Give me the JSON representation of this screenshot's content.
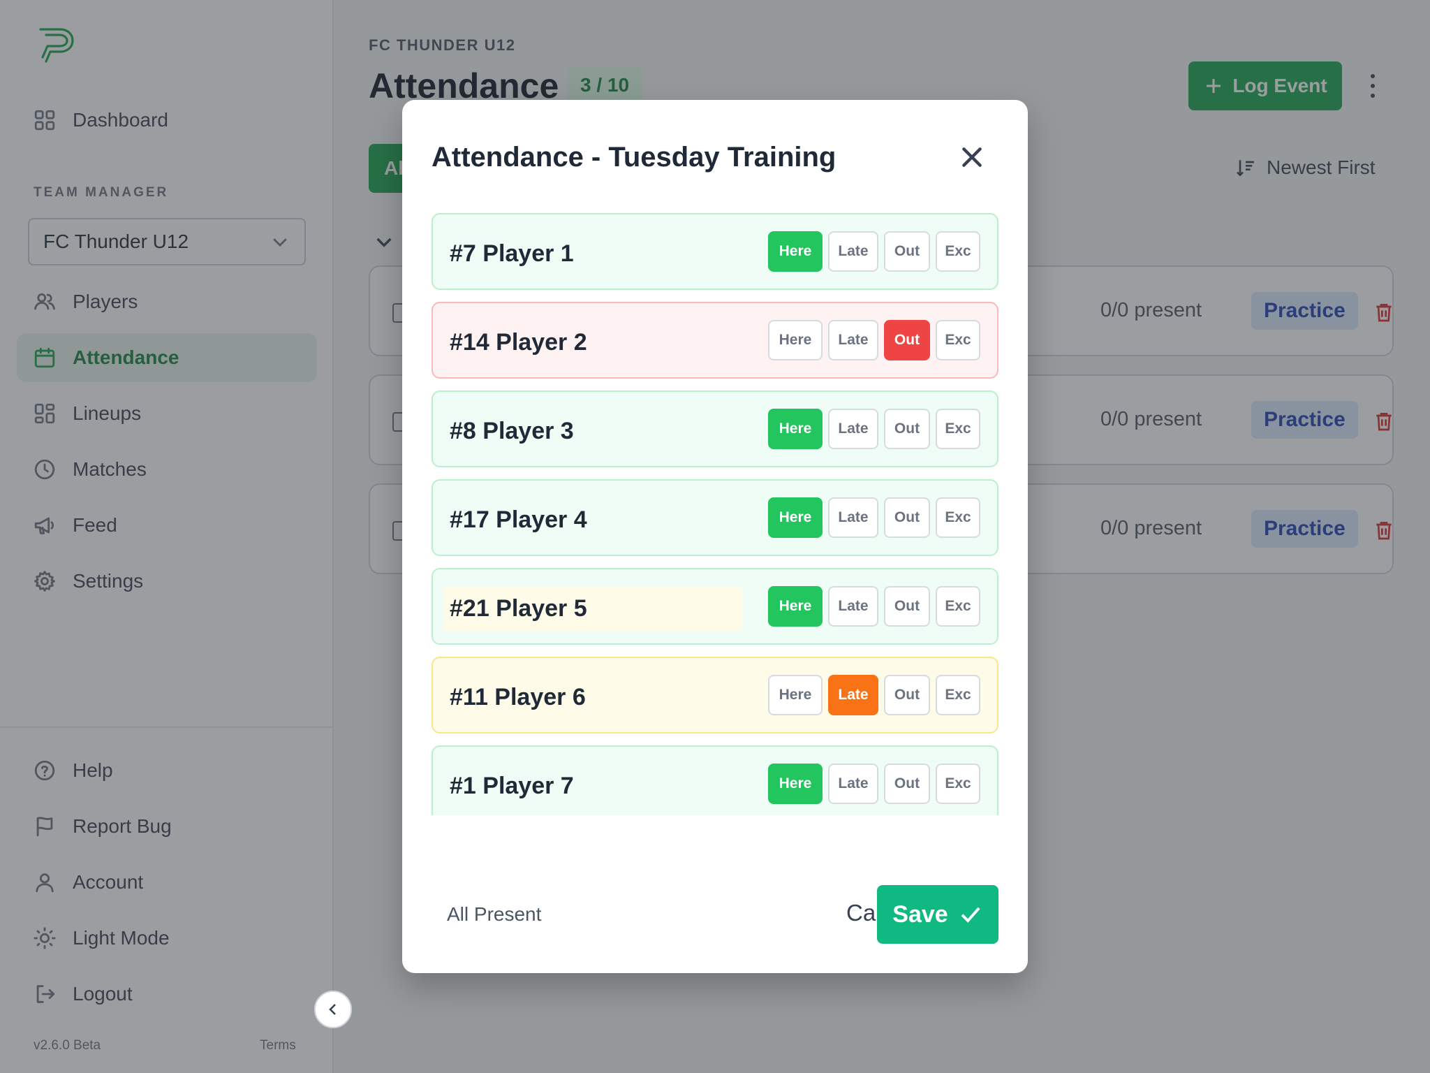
{
  "sidebar": {
    "nav": [
      {
        "label": "Dashboard",
        "icon": "grid-icon"
      },
      {
        "label": "Players",
        "icon": "users-icon"
      },
      {
        "label": "Attendance",
        "icon": "calendar-icon",
        "active": true
      },
      {
        "label": "Lineups",
        "icon": "layout-icon"
      },
      {
        "label": "Matches",
        "icon": "clock-icon"
      },
      {
        "label": "Feed",
        "icon": "megaphone-icon"
      },
      {
        "label": "Settings",
        "icon": "gear-icon"
      }
    ],
    "section_label": "TEAM MANAGER",
    "team_select": "FC Thunder U12",
    "bottom_nav": [
      {
        "label": "Help",
        "icon": "help-icon"
      },
      {
        "label": "Report Bug",
        "icon": "flag-icon"
      },
      {
        "label": "Account",
        "icon": "user-icon"
      },
      {
        "label": "Light Mode",
        "icon": "sun-icon"
      },
      {
        "label": "Logout",
        "icon": "logout-icon"
      }
    ],
    "version": "v2.6.0 Beta",
    "terms": "Terms"
  },
  "header": {
    "breadcrumb": "FC THUNDER U12",
    "title": "Attendance",
    "count": "3 / 10",
    "log_event": "Log Event",
    "filter_tab": "Al",
    "sort": "Newest First"
  },
  "events": [
    {
      "present": "0/0 present",
      "type": "Practice"
    },
    {
      "present": "0/0 present",
      "type": "Practice"
    },
    {
      "present": "0/0 present",
      "type": "Practice"
    }
  ],
  "modal": {
    "title": "Attendance - Tuesday Training",
    "status_labels": {
      "here": "Here",
      "late": "Late",
      "out": "Out",
      "exc": "Exc"
    },
    "players": [
      {
        "name": "#7 Player 1",
        "status": "here"
      },
      {
        "name": "#14 Player 2",
        "status": "out"
      },
      {
        "name": "#8 Player 3",
        "status": "here"
      },
      {
        "name": "#17 Player 4",
        "status": "here"
      },
      {
        "name": "#21 Player 5",
        "status": "here"
      },
      {
        "name": "#11 Player 6",
        "status": "late"
      },
      {
        "name": "#1 Player 7",
        "status": "here"
      },
      {
        "name": "",
        "status": "here"
      }
    ],
    "all_present": "All Present",
    "cancel": "Cancel",
    "save": "Save"
  },
  "colors": {
    "brand_green": "#16a34a",
    "here": "#22c55e",
    "out": "#ef4444",
    "late": "#f97316",
    "practice_badge": "#dbeafe"
  }
}
